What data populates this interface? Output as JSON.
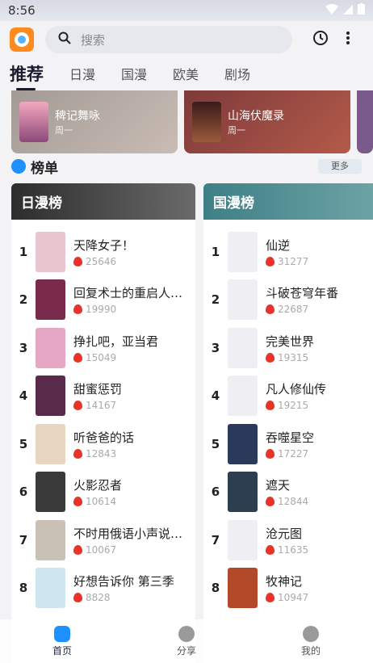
{
  "status": {
    "time": "8:56"
  },
  "search": {
    "placeholder": "搜索"
  },
  "tabs": [
    "推荐",
    "日漫",
    "国漫",
    "欧美",
    "剧场"
  ],
  "banners": [
    {
      "title": "稗记舞咏",
      "sub": "周一"
    },
    {
      "title": "山海伏魔录",
      "sub": "周一"
    }
  ],
  "rank": {
    "title": "榜单",
    "more": "更多"
  },
  "japan": {
    "title": "日漫榜",
    "items": [
      {
        "rank": "1",
        "title": "天降女子！",
        "score": "25646"
      },
      {
        "rank": "2",
        "title": "回复术士的重启人…",
        "score": "19990"
      },
      {
        "rank": "3",
        "title": "挣扎吧，亚当君",
        "score": "15049"
      },
      {
        "rank": "4",
        "title": "甜蜜惩罚",
        "score": "14167"
      },
      {
        "rank": "5",
        "title": "听爸爸的话",
        "score": "12843"
      },
      {
        "rank": "6",
        "title": "火影忍者",
        "score": "10614"
      },
      {
        "rank": "7",
        "title": "不时用俄语小声说…",
        "score": "10067"
      },
      {
        "rank": "8",
        "title": "好想告诉你 第三季",
        "score": "8828"
      }
    ]
  },
  "china": {
    "title": "国漫榜",
    "items": [
      {
        "rank": "1",
        "title": "仙逆",
        "score": "31277"
      },
      {
        "rank": "2",
        "title": "斗破苍穹年番",
        "score": "22687"
      },
      {
        "rank": "3",
        "title": "完美世界",
        "score": "19315"
      },
      {
        "rank": "4",
        "title": "凡人修仙传",
        "score": "19215"
      },
      {
        "rank": "5",
        "title": "吞噬星空",
        "score": "17227"
      },
      {
        "rank": "6",
        "title": "遮天",
        "score": "12844"
      },
      {
        "rank": "7",
        "title": "沧元图",
        "score": "11635"
      },
      {
        "rank": "8",
        "title": "牧神记",
        "score": "10947"
      }
    ]
  },
  "nav": [
    "首页",
    "分享",
    "我的"
  ]
}
